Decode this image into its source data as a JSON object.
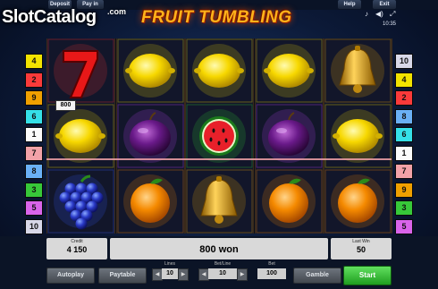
{
  "topbar": {
    "deposit": "Deposit",
    "payin": "Pay in",
    "help": "Help",
    "exit": "Exit"
  },
  "logo": {
    "text": "SlotCatalog",
    "domain": ".com"
  },
  "title": "FRUIT TUMBLING",
  "clock": "10:35",
  "icons": {
    "music": "music-icon",
    "sound": "speaker-icon",
    "fullscreen": "fullscreen-icon"
  },
  "left_lines": [
    "4",
    "2",
    "9",
    "6",
    "1",
    "7",
    "8",
    "3",
    "5",
    "10"
  ],
  "right_lines": [
    "10",
    "4",
    "2",
    "8",
    "6",
    "1",
    "7",
    "9",
    "3",
    "5"
  ],
  "reels": [
    [
      "seven",
      "lemon",
      "grapes"
    ],
    [
      "lemon",
      "plum",
      "orange"
    ],
    [
      "lemon",
      "watermelon",
      "bell"
    ],
    [
      "lemon",
      "plum",
      "orange"
    ],
    [
      "bell",
      "lemon",
      "orange"
    ]
  ],
  "win_badge": "800",
  "credit": {
    "label": "Credit",
    "value": "4 150"
  },
  "message": "800 won",
  "lastwin": {
    "label": "Last Win",
    "value": "50"
  },
  "buttons": {
    "autoplay": "Autoplay",
    "paytable": "Paytable",
    "gamble": "Gamble",
    "start": "Start"
  },
  "lines": {
    "label": "Lines",
    "value": "10"
  },
  "betline": {
    "label": "Bet/Line",
    "value": "10"
  },
  "bet": {
    "label": "Bet",
    "value": "100"
  },
  "colors": {
    "title": "#ffb21a",
    "start": "#2fb52f",
    "win_line": "#f2a2a8"
  }
}
